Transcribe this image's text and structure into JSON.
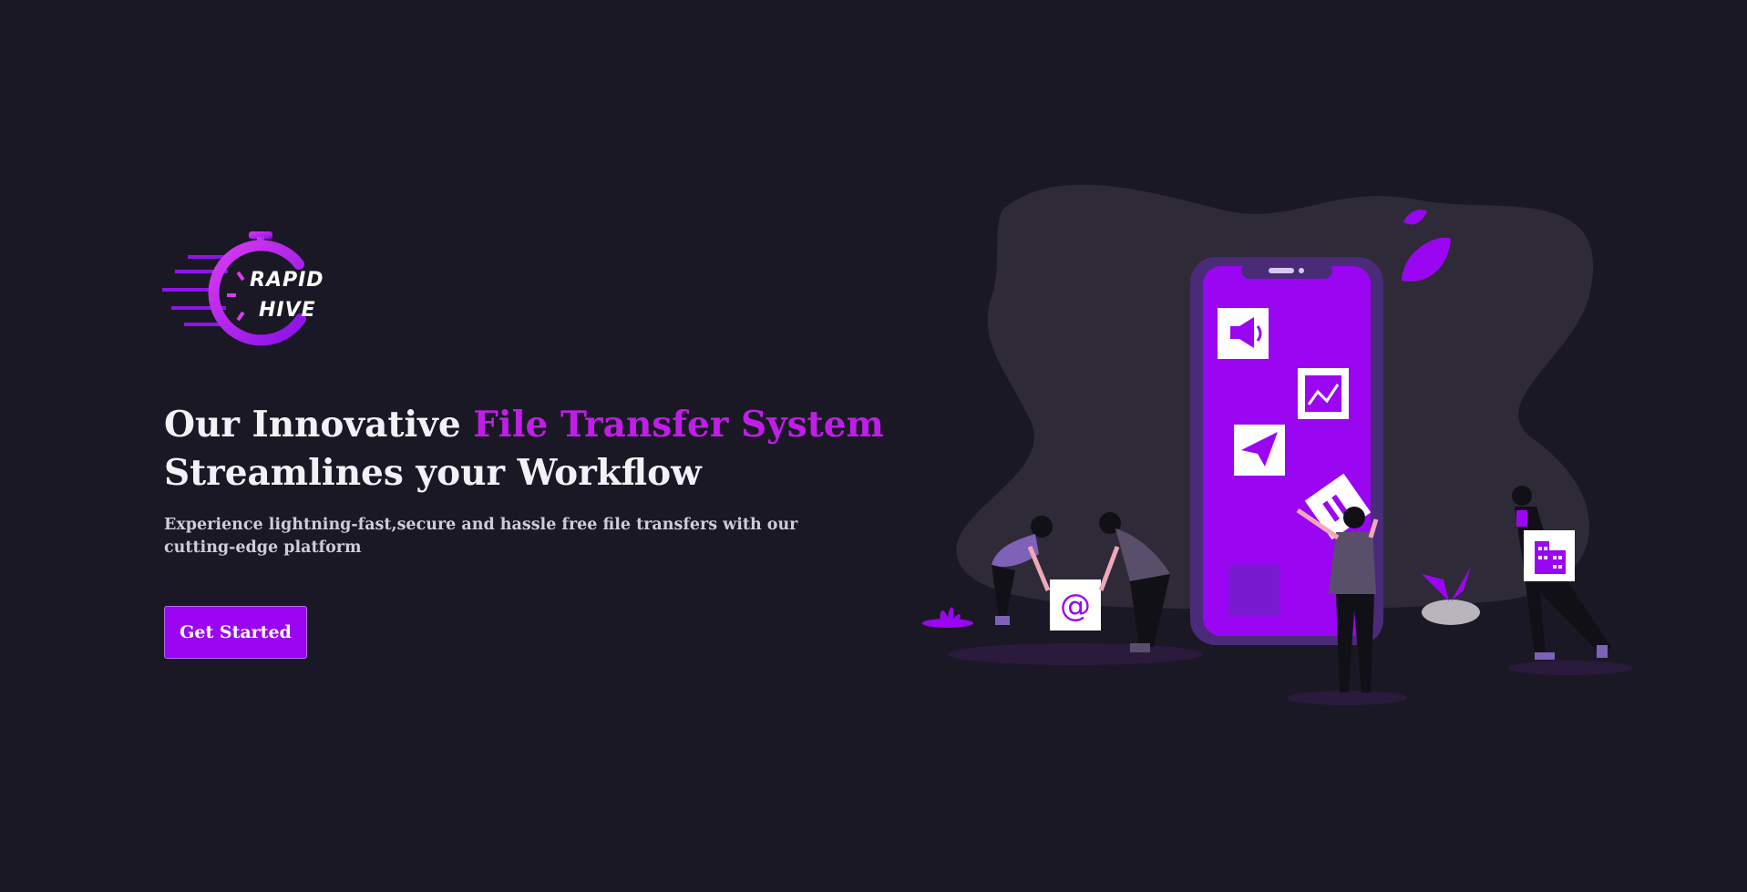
{
  "brand": {
    "logo_line1": "RAPID",
    "logo_line2": "HIVE"
  },
  "hero": {
    "title_part1": "Our Innovative ",
    "title_highlight": "File Transfer System",
    "title_part2": "Streamlines your Workflow",
    "subtitle": "Experience lightning-fast,secure and hassle free file transfers with our cutting-edge platform",
    "cta_label": "Get Started"
  },
  "illustration": {
    "icons": [
      "megaphone-icon",
      "chart-icon",
      "paper-plane-icon",
      "document-icon",
      "at-sign-icon",
      "building-icon"
    ]
  },
  "colors": {
    "background": "#1b1825",
    "accent": "#c01ee8",
    "button": "#9a06f1",
    "text": "#f3f1f6"
  }
}
